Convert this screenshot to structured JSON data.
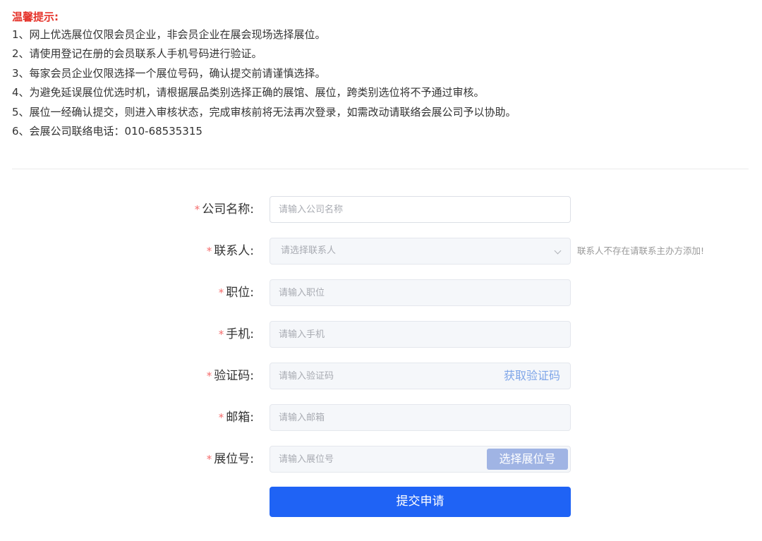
{
  "notice": {
    "title": "温馨提示:",
    "lines": [
      "1、网上优选展位仅限会员企业，非会员企业在展会现场选择展位。",
      "2、请使用登记在册的会员联系人手机号码进行验证。",
      "3、每家会员企业仅限选择一个展位号码，确认提交前请谨慎选择。",
      "4、为避免延误展位优选时机，请根据展品类别选择正确的展馆、展位，跨类别选位将不予通过审核。",
      "5、展位一经确认提交，则进入审核状态，完成审核前将无法再次登录，如需改动请联络会展公司予以协助。",
      "6、会展公司联络电话：010-68535315"
    ]
  },
  "form": {
    "required_mark": "*",
    "company": {
      "label": "公司名称:",
      "placeholder": "请输入公司名称"
    },
    "contact": {
      "label": "联系人:",
      "placeholder": "请选择联系人",
      "hint": "联系人不存在请联系主办方添加!"
    },
    "position": {
      "label": "职位:",
      "placeholder": "请输入职位"
    },
    "phone": {
      "label": "手机:",
      "placeholder": "请输入手机"
    },
    "code": {
      "label": "验证码:",
      "placeholder": "请输入验证码",
      "action": "获取验证码"
    },
    "email": {
      "label": "邮箱:",
      "placeholder": "请输入邮箱"
    },
    "booth": {
      "label": "展位号:",
      "placeholder": "请输入展位号",
      "action": "选择展位号"
    },
    "submit_label": "提交申请"
  },
  "colors": {
    "notice_title": "#e5332a",
    "required": "#f56c6c",
    "primary": "#1f63f5",
    "link": "#7ea5e8",
    "booth_button": "#a0b4e4"
  }
}
